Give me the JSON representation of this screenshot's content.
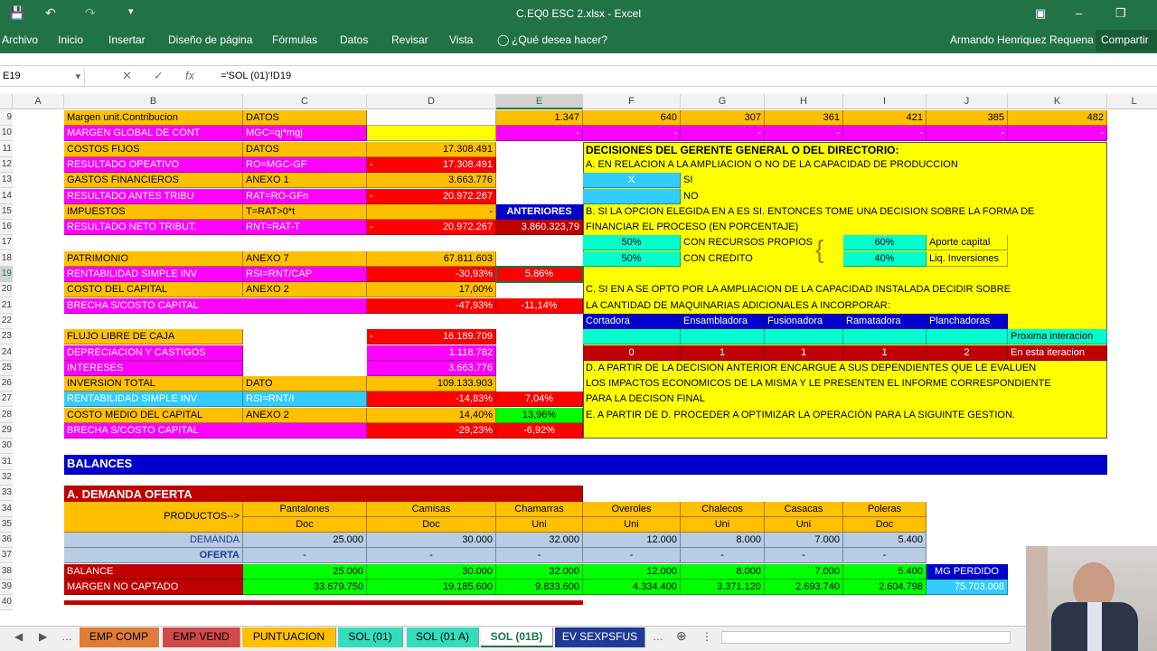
{
  "window": {
    "title": "C.EQ0 ESC 2.xlsx - Excel"
  },
  "ribbon": {
    "tabs": [
      "Archivo",
      "Inicio",
      "Insertar",
      "Diseño de página",
      "Fórmulas",
      "Datos",
      "Revisar",
      "Vista"
    ],
    "tell_me": "¿Qué desea hacer?",
    "user": "Armando Henriquez Requena",
    "share": "Compartir"
  },
  "formula_bar": {
    "name_box": "E19",
    "formula": "='SOL (01)'!D19",
    "fx": "fx"
  },
  "columns": [
    "A",
    "B",
    "C",
    "D",
    "E",
    "F",
    "G",
    "H",
    "I",
    "J",
    "K",
    "L"
  ],
  "rows": [
    "9",
    "10",
    "11",
    "12",
    "13",
    "14",
    "15",
    "16",
    "17",
    "18",
    "19",
    "20",
    "21",
    "22",
    "23",
    "24",
    "25",
    "26",
    "27",
    "28",
    "29",
    "30",
    "31",
    "32",
    "33",
    "34",
    "35",
    "36",
    "37",
    "38",
    "39",
    "40"
  ],
  "cells": {
    "b9": "Margen unit.Contribucion",
    "c9": "DATOS",
    "e9": "1.347",
    "f9": "640",
    "g9": "307",
    "h9": "361",
    "i9": "421",
    "j9": "385",
    "k9": "482",
    "b10": "MARGEN GLOBAL DE CONT",
    "c10": "MGC=qj*mgj",
    "e10": "-",
    "f10": "-",
    "g10": "-",
    "h10": "-",
    "i10": "-",
    "j10": "-",
    "k10": "-",
    "b11": "COSTOS FIJOS",
    "c11": "DATOS",
    "d11": "17.308.491",
    "b12": "RESULTADO OPEATIVO",
    "c12": "RO=MGC-GF",
    "d12_neg": "-",
    "d12": "17.308.491",
    "b13": "GASTOS FINANCIEROS",
    "c13": "ANEXO 1",
    "d13": "3.663.776",
    "b14": "RESULTADO ANTES TRIBU",
    "c14": "RAT=RO-GFn",
    "d14_neg": "-",
    "d14": "20.972.267",
    "b15": "IMPUESTOS",
    "c15": "T=RAT>0*t",
    "d15": "-",
    "e15": "ANTERIORES",
    "b16": "RESULTADO NETO TRIBUT.",
    "c16": "RNT=RAT-T",
    "d16_neg": "-",
    "d16": "20.972.267",
    "e16": "3.860.323,79",
    "b18": "PATRIMONIO",
    "c18": "ANEXO 7",
    "d18": "67.811.603",
    "b19": "RENTABILIDAD SIMPLE INV",
    "c19": "RSI=RNT/CAP",
    "d19": "-30,93%",
    "e19": "5,86%",
    "b20": "COSTO DEL CAPITAL",
    "c20": "ANEXO 2",
    "d20": "17,00%",
    "b21": "BRECHA S/COSTO CAPITAL",
    "d21": "-47,93%",
    "e21": "-11,14%",
    "b23": "FLUJO LIBRE DE CAJA",
    "d23_neg": "-",
    "d23": "16.189.709",
    "b24": "DEPRECIACION Y CASTIGOS",
    "d24": "1.118.782",
    "b25": "INTERESES",
    "d25": "3.663.776",
    "b26": "INVERSION TOTAL",
    "c26": "DATO",
    "d26": "109.133.903",
    "b27": "RENTABILIDAD SIMPLE INV",
    "c27": "RSI=RNT/I",
    "d27": "-14,83%",
    "e27": "7,04%",
    "b28": "COSTO MEDIO DEL CAPITAL",
    "c28": "ANEXO 2",
    "d28": "14,40%",
    "e28": "13,96%",
    "b29": "BRECHA S/COSTO CAPITAL",
    "d29": "-29,23%",
    "e29": "-6,92%"
  },
  "decisions": {
    "title": "DECISIONES DEL GERENTE GENERAL O DEL DIRECTORIO:",
    "a": "A. EN RELACION A LA AMPLIACION O NO DE LA CAPACIDAD DE PRODUCCION",
    "x": "X",
    "si": "SI",
    "no": "NO",
    "b1": "B. SI LA OPCION ELEGIDA EN A ES SI. ENTONCES TOME UNA DECISION SOBRE LA FORMA DE",
    "b2": "FINANCIAR EL PROCESO (EN PORCENTAJE)",
    "p1": "50%",
    "p1_label": "CON RECURSOS PROPIOS",
    "p2": "50%",
    "p2_label": "CON CREDITO",
    "q1": "60%",
    "q1_label": "Aporte capital",
    "q2": "40%",
    "q2_label": "Liq. Inversiones",
    "c1": "C. SI EN A SE OPTO POR LA AMPLIACION DE LA CAPACIDAD INSTALADA DECIDIR SOBRE",
    "c2": "LA CANTIDAD DE MAQUINARIAS ADICIONALES A INCORPORAR:",
    "machines": [
      "Cortadora",
      "Ensambladora",
      "Fusionadora",
      "Ramatadora",
      "Planchadoras"
    ],
    "next_label": "Proxima interacion",
    "current": [
      "0",
      "1",
      "1",
      "1",
      "2"
    ],
    "current_label": "En esta iteracion",
    "d1": "D. A PARTIR DE LA DECISION ANTERIOR ENCARGUE A SUS DEPENDIENTES QUE LE EVALUEN",
    "d2": "LOS IMPACTOS ECONOMICOS DE LA MISMA Y LE PRESENTEN EL INFORME CORRESPONDIENTE",
    "d3": "PARA LA DECISON FINAL",
    "e": "E. A PARTIR DE D. PROCEDER A OPTIMIZAR LA OPERACIÓN PARA LA SIGUINTE GESTION."
  },
  "balances": {
    "title": "BALANCES",
    "section": "A. DEMANDA OFERTA",
    "products_label": "PRODUCTOS-->",
    "products": [
      "Pantalones",
      "Camisas",
      "Chamarras",
      "Overoles",
      "Chalecos",
      "Casacas",
      "Poleras"
    ],
    "units": [
      "Doc",
      "Doc",
      "Uni",
      "Uni",
      "Uni",
      "Uni",
      "Doc"
    ],
    "demanda_label": "DEMANDA",
    "demanda": [
      "25.000",
      "30.000",
      "32.000",
      "12.000",
      "8.000",
      "7.000",
      "5.400"
    ],
    "oferta_label": "OFERTA",
    "oferta": [
      "-",
      "-",
      "-",
      "-",
      "-",
      "-",
      "-"
    ],
    "balance_label": "BALANCE",
    "balance": [
      "25.000",
      "30.000",
      "32.000",
      "12.000",
      "8.000",
      "7.000",
      "5.400"
    ],
    "margen_label": "MARGEN NO CAPTADO",
    "margen": [
      "33.679.750",
      "19.185.600",
      "9.833.600",
      "4.334.400",
      "3.371.120",
      "2.693.740",
      "2.604.798"
    ],
    "mg_perdido_label": "MG PERDIDO",
    "mg_perdido": "75.703.008"
  },
  "sheet_tabs": [
    "EMP COMP",
    "EMP VEND",
    "PUNTUACION",
    "SOL (01)",
    "SOL (01 A)",
    "SOL (01B)",
    "EV SEXPSFUS"
  ],
  "active_tab": "SOL (01B)",
  "tab_colors": [
    "#e07b39",
    "#d14a4a",
    "#ffc000",
    "#33ddbb",
    "#33ddbb",
    "#ffffff",
    "#1f3a93"
  ]
}
